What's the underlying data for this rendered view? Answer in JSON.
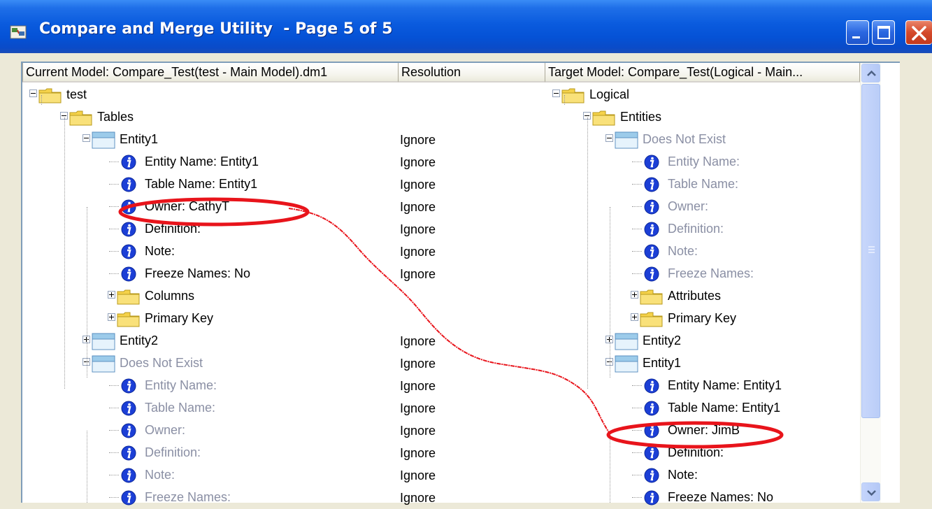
{
  "window": {
    "title": "Compare and Merge Utility  - Page 5 of 5"
  },
  "columns": {
    "current_model": "Current Model: Compare_Test(test - Main Model).dm1",
    "resolution": "Resolution",
    "target_model": "Target Model: Compare_Test(Logical - Main..."
  },
  "left_tree": [
    {
      "label": "test",
      "type": "folder",
      "depth": 0,
      "toggle": "minus",
      "resolution": ""
    },
    {
      "label": "Tables",
      "type": "folder",
      "depth": 1,
      "toggle": "minus",
      "resolution": ""
    },
    {
      "label": "Entity1",
      "type": "table",
      "depth": 2,
      "toggle": "minus",
      "resolution": "Ignore"
    },
    {
      "label": "Entity Name: Entity1",
      "type": "info",
      "depth": 3,
      "resolution": "Ignore"
    },
    {
      "label": "Table Name: Entity1",
      "type": "info",
      "depth": 3,
      "resolution": "Ignore"
    },
    {
      "label": "Owner: CathyT",
      "type": "info",
      "depth": 3,
      "resolution": "Ignore"
    },
    {
      "label": "Definition:",
      "type": "info",
      "depth": 3,
      "resolution": "Ignore"
    },
    {
      "label": "Note:",
      "type": "info",
      "depth": 3,
      "resolution": "Ignore"
    },
    {
      "label": "Freeze Names: No",
      "type": "info",
      "depth": 3,
      "resolution": "Ignore"
    },
    {
      "label": "Columns",
      "type": "folder",
      "depth": 3,
      "toggle": "plus",
      "resolution": ""
    },
    {
      "label": "Primary Key",
      "type": "folder",
      "depth": 3,
      "toggle": "plus",
      "resolution": ""
    },
    {
      "label": "Entity2",
      "type": "table",
      "depth": 2,
      "toggle": "plus",
      "resolution": "Ignore"
    },
    {
      "label": "Does Not Exist",
      "type": "table",
      "depth": 2,
      "toggle": "minus",
      "resolution": "Ignore",
      "missing": true
    },
    {
      "label": "Entity Name:",
      "type": "info",
      "depth": 3,
      "resolution": "Ignore",
      "missing": true
    },
    {
      "label": "Table Name:",
      "type": "info",
      "depth": 3,
      "resolution": "Ignore",
      "missing": true
    },
    {
      "label": "Owner:",
      "type": "info",
      "depth": 3,
      "resolution": "Ignore",
      "missing": true
    },
    {
      "label": "Definition:",
      "type": "info",
      "depth": 3,
      "resolution": "Ignore",
      "missing": true
    },
    {
      "label": "Note:",
      "type": "info",
      "depth": 3,
      "resolution": "Ignore",
      "missing": true
    },
    {
      "label": "Freeze Names:",
      "type": "info",
      "depth": 3,
      "resolution": "Ignore",
      "missing": true
    }
  ],
  "right_tree": [
    {
      "label": "Logical",
      "type": "folder",
      "depth": 0,
      "toggle": "minus"
    },
    {
      "label": "Entities",
      "type": "folder",
      "depth": 1,
      "toggle": "minus"
    },
    {
      "label": "Does Not Exist",
      "type": "table",
      "depth": 2,
      "toggle": "minus",
      "missing": true
    },
    {
      "label": "Entity Name:",
      "type": "info",
      "depth": 3,
      "missing": true
    },
    {
      "label": "Table Name:",
      "type": "info",
      "depth": 3,
      "missing": true
    },
    {
      "label": "Owner:",
      "type": "info",
      "depth": 3,
      "missing": true
    },
    {
      "label": "Definition:",
      "type": "info",
      "depth": 3,
      "missing": true
    },
    {
      "label": "Note:",
      "type": "info",
      "depth": 3,
      "missing": true
    },
    {
      "label": "Freeze Names:",
      "type": "info",
      "depth": 3,
      "missing": true
    },
    {
      "label": "Attributes",
      "type": "folder",
      "depth": 3,
      "toggle": "plus"
    },
    {
      "label": "Primary Key",
      "type": "folder",
      "depth": 3,
      "toggle": "plus"
    },
    {
      "label": "Entity2",
      "type": "table",
      "depth": 2,
      "toggle": "plus"
    },
    {
      "label": "Entity1",
      "type": "table",
      "depth": 2,
      "toggle": "minus"
    },
    {
      "label": "Entity Name: Entity1",
      "type": "info",
      "depth": 3
    },
    {
      "label": "Table Name: Entity1",
      "type": "info",
      "depth": 3
    },
    {
      "label": "Owner: JimB",
      "type": "info",
      "depth": 3
    },
    {
      "label": "Definition:",
      "type": "info",
      "depth": 3
    },
    {
      "label": "Note:",
      "type": "info",
      "depth": 3
    },
    {
      "label": "Freeze Names: No",
      "type": "info",
      "depth": 3
    }
  ],
  "annotations": {
    "highlighted_left": "Owner: CathyT",
    "highlighted_right": "Owner: JimB",
    "color": "#E8141B"
  },
  "colors": {
    "titlebar": "#0A5BDE",
    "missing_text": "#8A8FA4",
    "info_icon": "#1C3FD6",
    "folder": "#F5D24A"
  }
}
